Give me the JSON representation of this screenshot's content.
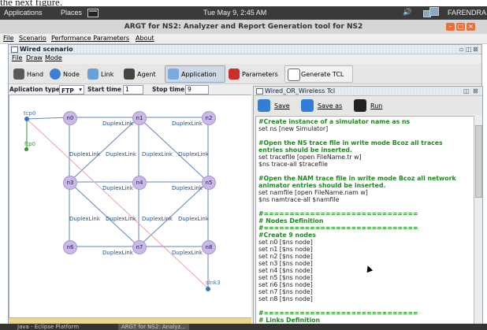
{
  "caption": "the next figure.",
  "panel": {
    "applications": "Applications",
    "places": "Places",
    "clock": "Tue May  9, 2:45 AM",
    "user": "FARENDRA"
  },
  "window": {
    "title": "ARGT for NS2: Analyzer and Report Generation tool for NS2",
    "menu": [
      "File",
      "Scenario",
      "Performance Parameters",
      "About"
    ]
  },
  "scenario_frame": {
    "title": "Wired scenario",
    "menu": [
      "File",
      "Draw",
      "Mode"
    ],
    "toolbar": [
      "Hand",
      "Node",
      "Link",
      "Agent",
      "Application",
      "Parameters",
      "Generate TCL"
    ],
    "active_tool": "Application",
    "app_row": {
      "type_label": "Aplication type",
      "type_value": "FTP",
      "start_label": "Start time",
      "start_value": "1",
      "stop_label": "Stop time",
      "stop_value": "9"
    },
    "nodes": [
      "n0",
      "n1",
      "n2",
      "n3",
      "n4",
      "n5",
      "n6",
      "n7",
      "n8"
    ],
    "link_label": "DuplexLink",
    "agents": [
      "tcp0",
      "ftp0",
      "sink3"
    ]
  },
  "editor_frame": {
    "title": "Wired_OR_Wireless Tcl",
    "buttons": [
      "Save",
      "Save as",
      "Run"
    ],
    "code": [
      {
        "t": "#Create instance of a simulator name as ns",
        "k": "c"
      },
      {
        "t": "set ns [new Simulator]",
        "k": "p"
      },
      {
        "t": "",
        "k": "p"
      },
      {
        "t": "#Open the NS trace file in write mode Bcoz all traces",
        "k": "c"
      },
      {
        "t": "entries should be inserted.",
        "k": "c"
      },
      {
        "t": "set tracefile [open FileName.tr w]",
        "k": "p"
      },
      {
        "t": "$ns trace-all $tracefile",
        "k": "p"
      },
      {
        "t": "",
        "k": "p"
      },
      {
        "t": "#Open the NAM trace file in write mode Bcoz all network",
        "k": "c"
      },
      {
        "t": "animator entries should be inserted.",
        "k": "c"
      },
      {
        "t": "set namfile [open FileName.nam w]",
        "k": "p"
      },
      {
        "t": "$ns namtrace-all $namfile",
        "k": "p"
      },
      {
        "t": "",
        "k": "p"
      },
      {
        "t": "#==============================",
        "k": "c"
      },
      {
        "t": "#       Nodes Definition",
        "k": "c"
      },
      {
        "t": "#==============================",
        "k": "c"
      },
      {
        "t": "#Create 9 nodes",
        "k": "c"
      },
      {
        "t": "set n0 [$ns node]",
        "k": "p"
      },
      {
        "t": "set n1 [$ns node]",
        "k": "p"
      },
      {
        "t": "set n2 [$ns node]",
        "k": "p"
      },
      {
        "t": "set n3 [$ns node]",
        "k": "p"
      },
      {
        "t": "set n4 [$ns node]",
        "k": "p"
      },
      {
        "t": "set n5 [$ns node]",
        "k": "p"
      },
      {
        "t": "set n6 [$ns node]",
        "k": "p"
      },
      {
        "t": "set n7 [$ns node]",
        "k": "p"
      },
      {
        "t": "set n8 [$ns node]",
        "k": "p"
      },
      {
        "t": "",
        "k": "p"
      },
      {
        "t": "#==============================",
        "k": "c"
      },
      {
        "t": "#       Links Definition",
        "k": "c"
      }
    ]
  },
  "taskbar": [
    "Java - Eclipse Platform",
    "ARGT for NS2: Analyz..."
  ],
  "colors": {
    "accent": "#8fa7c4",
    "node": "#c9b8e8",
    "comment": "#1f8a1f",
    "link": "#5b86c2"
  }
}
